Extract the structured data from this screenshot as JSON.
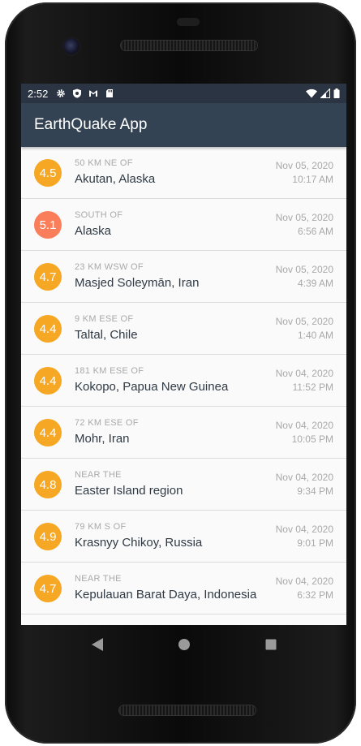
{
  "status": {
    "time": "2:52",
    "icons_left": [
      "gear-icon",
      "shield-icon",
      "gmail-icon",
      "sdcard-icon"
    ],
    "icons_right": [
      "wifi-icon",
      "signal-icon",
      "battery-icon"
    ]
  },
  "app": {
    "title": "EarthQuake App",
    "bar_color": "#344353",
    "status_color": "#2b3442"
  },
  "colors": {
    "mag_4": "#f6a723",
    "mag_5": "#fb7e5a"
  },
  "quakes": [
    {
      "mag": "4.5",
      "offset": "50 KM NE OF",
      "place": "Akutan, Alaska",
      "date": "Nov 05, 2020",
      "time": "10:17 AM",
      "color": "#f6a723"
    },
    {
      "mag": "5.1",
      "offset": "SOUTH OF",
      "place": "Alaska",
      "date": "Nov 05, 2020",
      "time": "6:56 AM",
      "color": "#fb7e5a"
    },
    {
      "mag": "4.7",
      "offset": "23 KM WSW OF",
      "place": "Masjed Soleymān, Iran",
      "date": "Nov 05, 2020",
      "time": "4:39 AM",
      "color": "#f6a723"
    },
    {
      "mag": "4.4",
      "offset": "9 KM ESE OF",
      "place": "Taltal, Chile",
      "date": "Nov 05, 2020",
      "time": "1:40 AM",
      "color": "#f6a723"
    },
    {
      "mag": "4.4",
      "offset": "181 KM ESE OF",
      "place": "Kokopo, Papua New Guinea",
      "date": "Nov 04, 2020",
      "time": "11:52 PM",
      "color": "#f6a723"
    },
    {
      "mag": "4.4",
      "offset": "72 KM ESE OF",
      "place": "Mohr, Iran",
      "date": "Nov 04, 2020",
      "time": "10:05 PM",
      "color": "#f6a723"
    },
    {
      "mag": "4.8",
      "offset": "NEAR THE",
      "place": "Easter Island region",
      "date": "Nov 04, 2020",
      "time": "9:34 PM",
      "color": "#f6a723"
    },
    {
      "mag": "4.9",
      "offset": "79 KM S OF",
      "place": "Krasnyy Chikoy, Russia",
      "date": "Nov 04, 2020",
      "time": "9:01 PM",
      "color": "#f6a723"
    },
    {
      "mag": "4.7",
      "offset": "NEAR THE",
      "place": "Kepulauan Barat Daya, Indonesia",
      "date": "Nov 04, 2020",
      "time": "6:32 PM",
      "color": "#f6a723"
    }
  ],
  "nav": {
    "back": "back-triangle-icon",
    "home": "home-circle-icon",
    "recents": "recents-square-icon"
  }
}
